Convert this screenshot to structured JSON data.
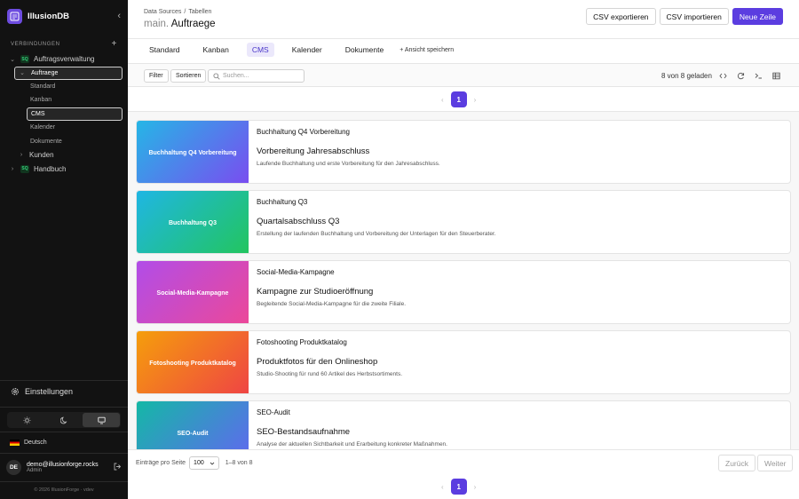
{
  "app": {
    "name": "IllusionDB"
  },
  "sidebar": {
    "section_label": "VERBINDUNGEN",
    "tree": [
      {
        "label": "Auftragsverwaltung",
        "badge": "SQ",
        "level": 0
      },
      {
        "label": "Auftraege",
        "level": 1,
        "selected": true
      },
      {
        "label": "Standard",
        "level": 2
      },
      {
        "label": "Kanban",
        "level": 2
      },
      {
        "label": "CMS",
        "level": 2,
        "selected": true
      },
      {
        "label": "Kalender",
        "level": 2
      },
      {
        "label": "Dokumente",
        "level": 2
      },
      {
        "label": "Kunden",
        "level": 1
      },
      {
        "label": "Handbuch",
        "badge": "SQ",
        "level": 0
      }
    ],
    "settings_label": "Einstellungen",
    "language": "Deutsch",
    "user": {
      "initials": "DE",
      "email": "demo@illusionforge.rocks",
      "role": "Admin"
    },
    "copyright": "© 2026 IllusionForge · vdev"
  },
  "header": {
    "breadcrumb": [
      "Data Sources",
      "Tabellen"
    ],
    "title_prefix": "main.",
    "title": "Auftraege",
    "buttons": {
      "export": "CSV exportieren",
      "import": "CSV importieren",
      "new_row": "Neue Zeile"
    }
  },
  "tabs": [
    "Standard",
    "Kanban",
    "CMS",
    "Kalender",
    "Dokumente"
  ],
  "save_view": "+ Ansicht speichern",
  "toolbar": {
    "filter": "Filter",
    "sort": "Sortieren",
    "search_placeholder": "Suchen...",
    "loaded": "8 von 8 geladen"
  },
  "pagination": {
    "current": "1"
  },
  "cards": [
    {
      "category": "Buchhaltung Q4 Vorbereitung",
      "title": "Vorbereitung Jahresabschluss",
      "desc": "Laufende Buchhaltung und erste Vorbereitung für den Jahresabschluss.",
      "thumb": "Buchhaltung Q4 Vorbereitung",
      "colors": [
        "#25b6e6",
        "#7a4cf0"
      ]
    },
    {
      "category": "Buchhaltung Q3",
      "title": "Quartalsabschluss Q3",
      "desc": "Erstellung der laufenden Buchhaltung und Vorbereitung der Unterlagen für den Steuerberater.",
      "thumb": "Buchhaltung Q3",
      "colors": [
        "#1fb6e3",
        "#22c55e"
      ]
    },
    {
      "category": "Social-Media-Kampagne",
      "title": "Kampagne zur Studioeröffnung",
      "desc": "Begleitende Social-Media-Kampagne für die zweite Filiale.",
      "thumb": "Social-Media-Kampagne",
      "colors": [
        "#b14de8",
        "#ec4899"
      ]
    },
    {
      "category": "Fotoshooting Produktkatalog",
      "title": "Produktfotos für den Onlineshop",
      "desc": "Studio-Shooting für rund 60 Artikel des Herbstsortiments.",
      "thumb": "Fotoshooting Produktkatalog",
      "colors": [
        "#f59e0b",
        "#ef4444"
      ]
    },
    {
      "category": "SEO-Audit",
      "title": "SEO-Bestandsaufnahme",
      "desc": "Analyse der aktuellen Sichtbarkeit und Erarbeitung konkreter Maßnahmen.",
      "thumb": "SEO-Audit",
      "colors": [
        "#14b8a6",
        "#6366f1"
      ]
    }
  ],
  "footer": {
    "per_page_label": "Einträge pro Seite",
    "per_page": "100",
    "range": "1–8 von 8",
    "back": "Zurück",
    "next": "Weiter"
  }
}
